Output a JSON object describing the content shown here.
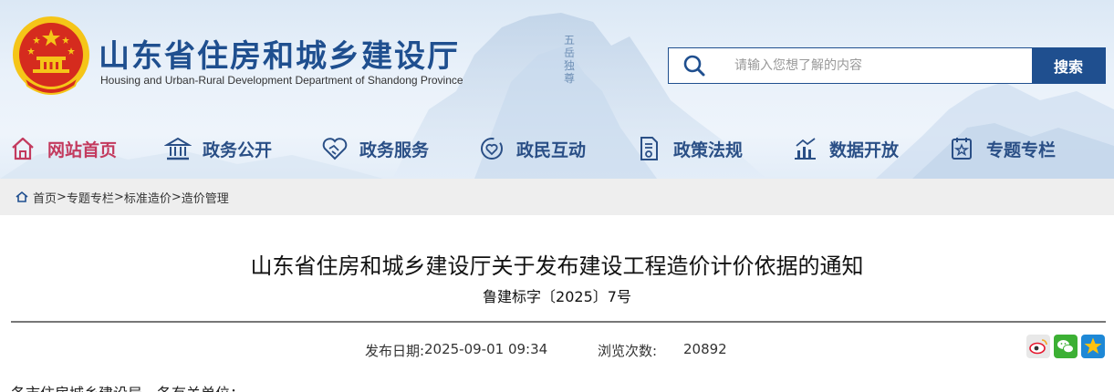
{
  "header": {
    "site_title": "山东省住房和城乡建设厅",
    "site_subtitle": "Housing and Urban-Rural Development Department of Shandong Province",
    "search": {
      "placeholder": "请输入您想了解的内容",
      "button_label": "搜索"
    }
  },
  "nav": {
    "items": [
      {
        "label": "网站首页",
        "icon": "home-icon",
        "active": true
      },
      {
        "label": "政务公开",
        "icon": "government-building-icon"
      },
      {
        "label": "政务服务",
        "icon": "handshake-icon"
      },
      {
        "label": "政民互动",
        "icon": "interaction-icon"
      },
      {
        "label": "政策法规",
        "icon": "policy-document-icon"
      },
      {
        "label": "数据开放",
        "icon": "chart-icon"
      },
      {
        "label": "专题专栏",
        "icon": "topic-icon"
      }
    ]
  },
  "breadcrumb": {
    "items": [
      "首页",
      "专题专栏",
      "标准造价",
      "造价管理"
    ],
    "separator": ">"
  },
  "article": {
    "title": "山东省住房和城乡建设厅关于发布建设工程造价计价依据的通知",
    "doc_number": "鲁建标字〔2025〕7号",
    "publish_label": "发布日期:",
    "publish_date": "2025-09-01 09:34",
    "views_label": "浏览次数:",
    "views_count": "20892",
    "body_first_line": "各市住房城乡建设局，各有关单位："
  },
  "share": [
    "weibo-icon",
    "wechat-icon",
    "qzone-icon"
  ],
  "colors": {
    "brand_blue": "#1f4f8f",
    "nav_blue": "#2a4f86",
    "nav_active": "#c33a5e",
    "emblem_red": "#d52b1e",
    "emblem_gold": "#f5c518"
  }
}
